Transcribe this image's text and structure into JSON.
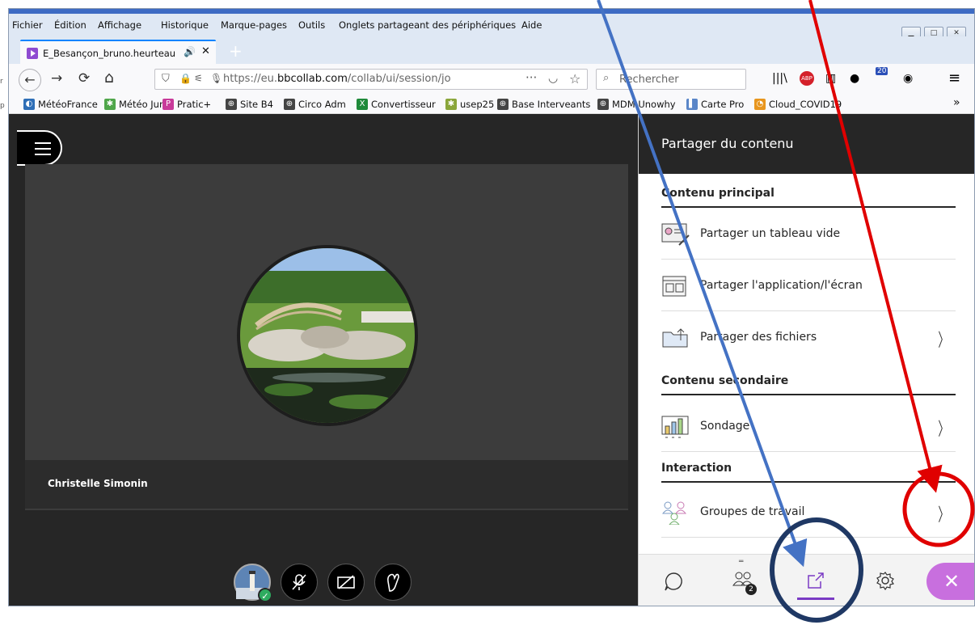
{
  "menubar": {
    "items": [
      "Fichier",
      "Édition",
      "Affichage",
      "Historique",
      "Marque-pages",
      "Outils",
      "Onglets partageant des périphériques",
      "Aide"
    ]
  },
  "tab": {
    "title": "E_Besançon_bruno.heurteau",
    "speaker": "🔊",
    "close": "✕",
    "new": "+"
  },
  "navbar": {
    "back": "←",
    "forward": "→",
    "reload": "⟳",
    "home": "⌂",
    "url_prefix": "https://eu.",
    "url_domain": "bbcollab.com",
    "url_path": "/collab/ui/session/jo",
    "dots": "···",
    "search_placeholder": "Rechercher",
    "menu": "≡"
  },
  "bookmarks": [
    {
      "label": "MétéoFrance",
      "color": "#2f6fb7",
      "glyph": "◐"
    },
    {
      "label": "Météo Jura",
      "color": "#4fa64a",
      "glyph": "✱"
    },
    {
      "label": "Pratic+",
      "color": "#c83a9a",
      "glyph": "P"
    },
    {
      "label": "Site B4",
      "color": "#444",
      "glyph": "⊕"
    },
    {
      "label": "Circo Adm",
      "color": "#444",
      "glyph": "⊕"
    },
    {
      "label": "Convertisseur",
      "color": "#1f8a3a",
      "glyph": "X"
    },
    {
      "label": "usep25",
      "color": "#8aa63a",
      "glyph": "✱"
    },
    {
      "label": "Base Interveants",
      "color": "#444",
      "glyph": "⊕"
    },
    {
      "label": "MDM Unowhy",
      "color": "#444",
      "glyph": "⊕"
    },
    {
      "label": "Carte Pro",
      "color": "#5a86c8",
      "glyph": "▌"
    },
    {
      "label": "Cloud_COVID19",
      "color": "#e8961e",
      "glyph": "◔"
    }
  ],
  "bookmarks_more": "»",
  "participant_name": "Christelle Simonin",
  "panel": {
    "title": "Partager du contenu",
    "sections": {
      "primary": "Contenu principal",
      "secondary": "Contenu secondaire",
      "interaction": "Interaction"
    },
    "items": {
      "whiteboard": "Partager un tableau vide",
      "app_screen": "Partager l'application/l'écran",
      "files": "Partager des fichiers",
      "poll": "Sondage",
      "groups": "Groupes de travail"
    },
    "chevron": "〉",
    "attendees_badge": "2"
  },
  "colors": {
    "accent": "#7a3ac4",
    "close": "#c86fde",
    "arrow_red": "#e00000",
    "arrow_blue": "#4472c4",
    "circle_navy": "#1f3864"
  }
}
